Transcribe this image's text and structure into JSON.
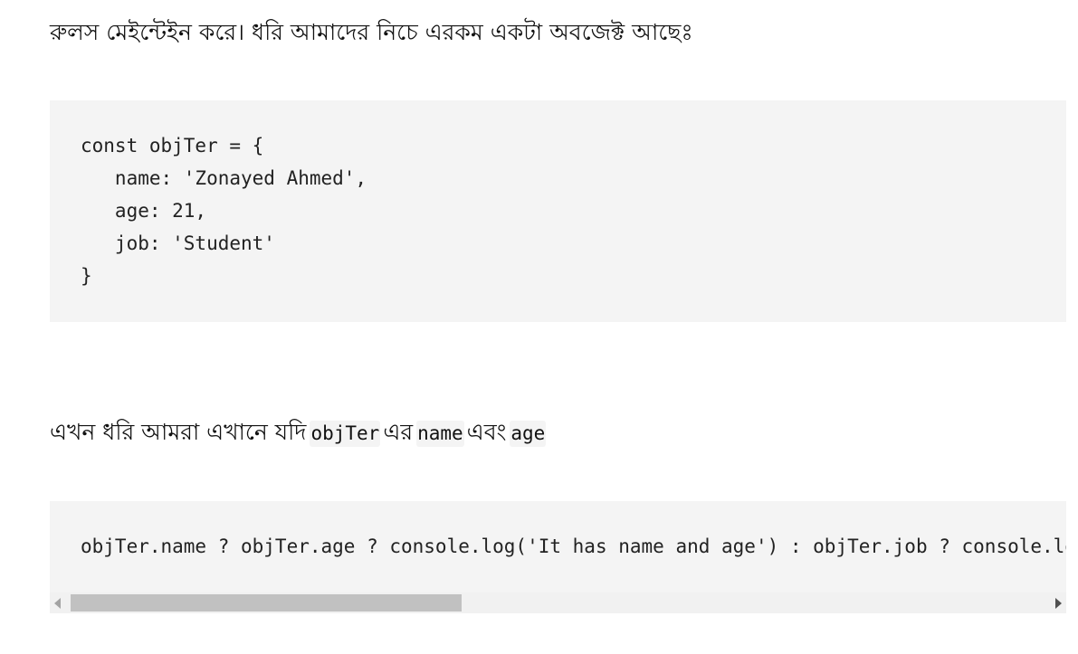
{
  "paragraphs": {
    "top": "রুলস মেইন্টেইন করে। ধরি আমাদের নিচে এরকম একটা অবজেক্ট আছেঃ",
    "middle": {
      "prefix": "এখন ধরি আমরা এখানে যদি",
      "code1": "objTer",
      "word1": "এর",
      "code2": "name",
      "word2": "এবং",
      "code3": "age"
    }
  },
  "code_block_1": {
    "lines": [
      "const objTer = {",
      "   name: 'Zonayed Ahmed',",
      "   age: 21,",
      "   job: 'Student'",
      "}"
    ]
  },
  "code_block_2": {
    "line": "objTer.name ? objTer.age ? console.log('It has name and age') : objTer.job ? console.log('It has job') : console.log('Nothing')",
    "scroll_position": 0.0
  }
}
